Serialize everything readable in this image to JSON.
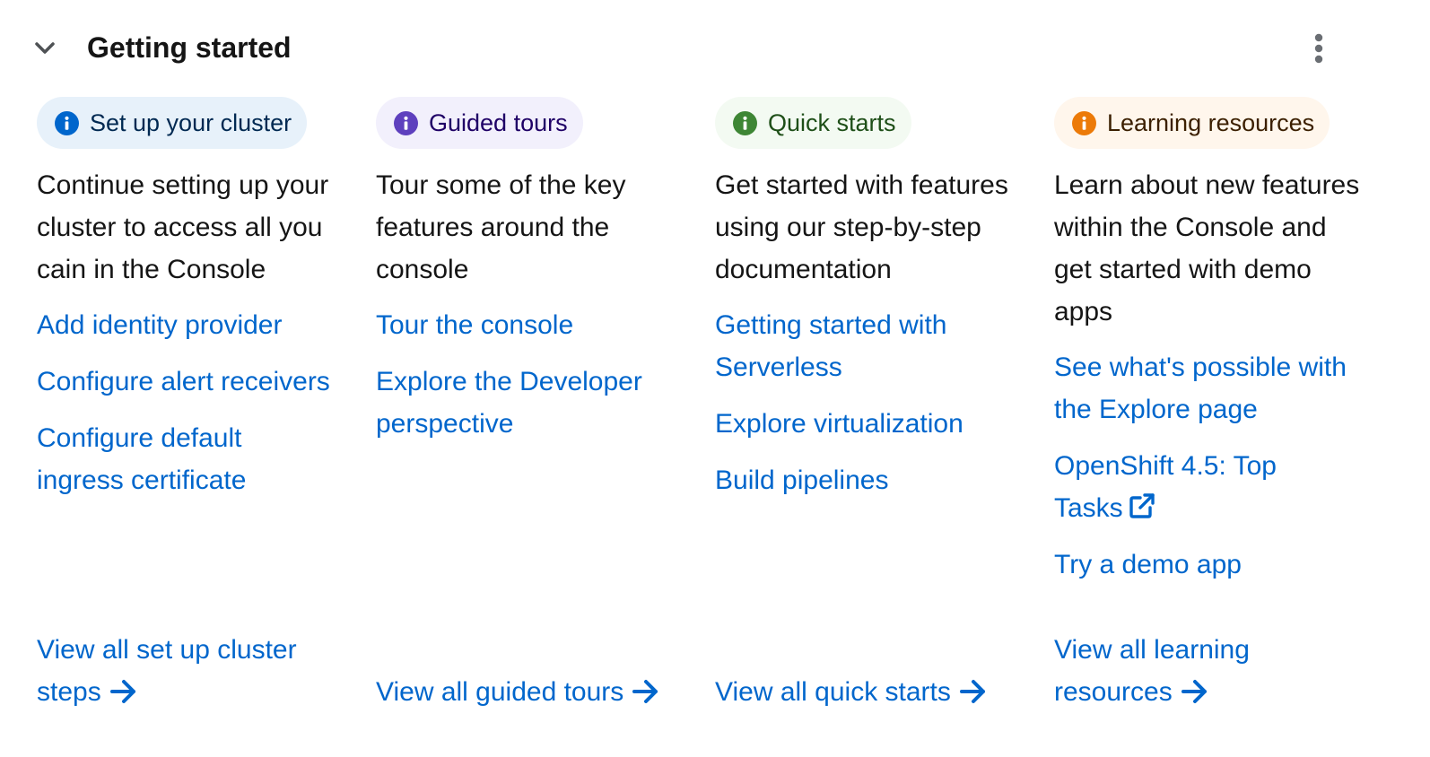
{
  "card": {
    "title": "Getting started"
  },
  "colors": {
    "link": "#0066cc",
    "blue_label_bg": "#e7f1fa",
    "blue_label_icon": "#0066cc",
    "purple_label_bg": "#f2f0fc",
    "purple_label_icon": "#5e40be",
    "green_label_bg": "#f3faf2",
    "green_label_icon": "#3e8635",
    "orange_label_bg": "#fff6ec",
    "orange_label_icon": "#ec7a08"
  },
  "columns": [
    {
      "label": "Set up your cluster",
      "description": "Continue setting up your cluster to access all you cain in the Console",
      "links": [
        "Add identity provider",
        "Configure alert receivers",
        "Configure default ingress certificate"
      ],
      "view_all": "View all set up cluster steps"
    },
    {
      "label": "Guided tours",
      "description": "Tour some of the key features around the console",
      "links": [
        "Tour the console",
        "Explore the Developer perspective"
      ],
      "view_all": "View all guided tours"
    },
    {
      "label": "Quick starts",
      "description": "Get started with features using our step-by-step documentation",
      "links": [
        "Getting started with Serverless",
        "Explore virtualization",
        "Build pipelines"
      ],
      "view_all": "View all quick starts"
    },
    {
      "label": "Learning resources",
      "description": "Learn about new features within the Console and get started with demo apps",
      "links": [
        "See what's possible with the Explore page",
        "OpenShift 4.5: Top Tasks",
        "Try a demo app"
      ],
      "view_all": "View all learning resources"
    }
  ],
  "icons": {
    "toggle": "chevron-down-icon",
    "menu": "kebab-icon",
    "label": "info-circle-icon",
    "external": "external-link-icon",
    "view_all": "arrow-right-icon"
  }
}
